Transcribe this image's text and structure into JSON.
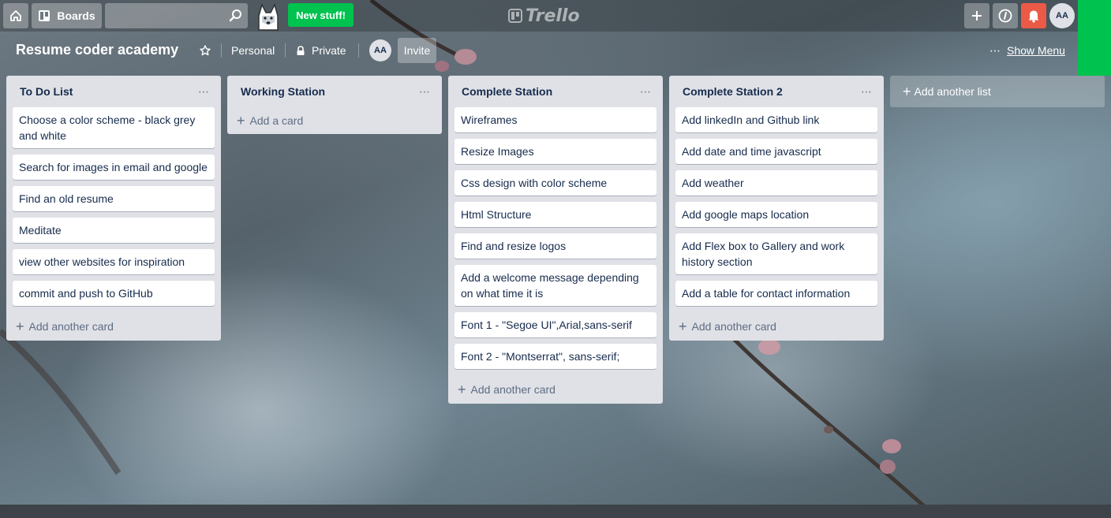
{
  "header": {
    "boards_label": "Boards",
    "search": {
      "value": "",
      "placeholder": ""
    },
    "new_stuff_label": "New stuff!",
    "logo_text": "Trello",
    "avatar_initials": "AA"
  },
  "board": {
    "title": "Resume coder academy",
    "team_label": "Personal",
    "visibility_label": "Private",
    "member_initials": "AA",
    "invite_label": "Invite",
    "show_menu_label": "Show Menu"
  },
  "lists": [
    {
      "title": "To Do List",
      "cards": [
        "Choose a color scheme - black grey and white",
        "Search for images in email and google",
        "Find an old resume",
        "Meditate",
        "view other websites for inspiration",
        "commit and push to GitHub"
      ],
      "add_label": "Add another card"
    },
    {
      "title": "Working Station",
      "cards": [],
      "add_label": "Add a card"
    },
    {
      "title": "Complete Station",
      "cards": [
        "Wireframes",
        "Resize Images",
        "Css design with color scheme",
        "Html Structure",
        "Find and resize logos",
        "Add a welcome message depending on what time it is",
        "Font 1 - \"Segoe UI\",Arial,sans-serif",
        "Font 2 - \"Montserrat\", sans-serif;"
      ],
      "add_label": "Add another card"
    },
    {
      "title": "Complete Station 2",
      "cards": [
        "Add linkedIn and Github link",
        "Add date and time javascript",
        "Add weather",
        "Add google maps location",
        "Add Flex box to Gallery and work history section",
        "Add a table for contact information"
      ],
      "add_label": "Add another card"
    }
  ],
  "add_list_label": "Add another list",
  "colors": {
    "new_stuff_green": "#00c24e",
    "notification_red": "#eb5a46",
    "list_bg": "#dfe1e6"
  }
}
